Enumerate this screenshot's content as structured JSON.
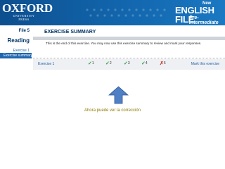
{
  "header": {
    "logo_main": "OXFORD",
    "logo_sub_1": "UNIVERSITY",
    "logo_sub_2": "PRESS",
    "course_new": "New",
    "course_title": "ENGLISH FILE",
    "course_level": "Pre-intermediate"
  },
  "sidebar": {
    "file": "File 5",
    "section": "Reading",
    "exercise": "Exercise 1",
    "summary": "Exercise summary"
  },
  "main": {
    "title": "EXERCISE SUMMARY",
    "summary_text": "This is the end of this exercise. You may now use this exercise summary to review and mark your responses.",
    "exercise_label": "Exercise 1",
    "mark_link": "Mark this exercise",
    "items": [
      {
        "number": "1",
        "mark": "✓",
        "color": "#2e9e3a"
      },
      {
        "number": "2",
        "mark": "✓",
        "color": "#2e9e3a"
      },
      {
        "number": "3",
        "mark": "✓",
        "color": "#2e9e3a"
      },
      {
        "number": "4",
        "mark": "✓",
        "color": "#2e9e3a"
      },
      {
        "number": "5",
        "mark": "✗",
        "color": "#d23c2e"
      }
    ]
  },
  "annotation": {
    "caption": "Ahora puede ver la corrección",
    "arrow_icon": "up-arrow-icon",
    "arrow_color": "#4f7fc4"
  }
}
